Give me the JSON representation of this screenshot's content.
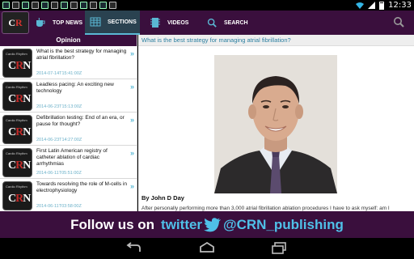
{
  "status_bar": {
    "time": "12:33"
  },
  "app": {
    "logo_text_c": "C",
    "logo_text_r": "R"
  },
  "tabs": [
    {
      "label": "TOP NEWS",
      "icon": "cup-icon",
      "selected": false
    },
    {
      "label": "SECTIONS",
      "icon": "grid-icon",
      "selected": true
    },
    {
      "label": "VIDEOS",
      "icon": "film-icon",
      "selected": false
    },
    {
      "label": "SEARCH",
      "icon": "search-icon",
      "selected": false
    }
  ],
  "sidebar": {
    "header": "Opinion",
    "thumb_caption": "Cardio Rhythm",
    "items": [
      {
        "title": "What is the best strategy for managing atrial fibrillation?",
        "date": "2014-07-14T15:41:00Z"
      },
      {
        "title": "Leadless pacing: An exciting new technology",
        "date": "2014-06-23T15:13:00Z"
      },
      {
        "title": "Defibrillation testing: End of an era, or pause for thought?",
        "date": "2014-06-23T14:27:00Z"
      },
      {
        "title": "First Latin American registry of catheter ablation of cardiac arrhythmias",
        "date": "2014-06-11T05:51:00Z"
      },
      {
        "title": "Towards resolving the role of M-cells in electrophysiology",
        "date": "2014-06-11T03:58:00Z"
      }
    ]
  },
  "article": {
    "title": "What is the best strategy for managing atrial fibrillation?",
    "byline": "By John D Day",
    "body": "After personally performing more than 3,000 atrial fibrillation ablation procedures I have to ask myself: am I"
  },
  "banner": {
    "lead": "Follow us on",
    "twitter": "twitter",
    "handle": "@CRN_publishing"
  },
  "colors": {
    "brand_purple": "#3a0f3d",
    "accent_blue": "#5ab8d4",
    "twitter_blue": "#4fc0e8"
  }
}
